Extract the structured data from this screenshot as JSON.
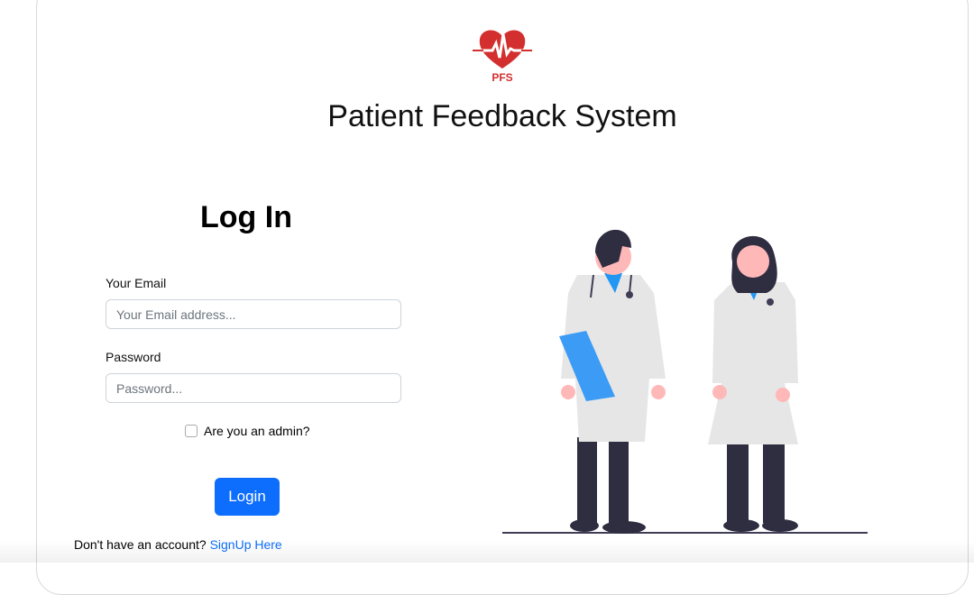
{
  "header": {
    "logo_text": "PFS",
    "title": "Patient Feedback System"
  },
  "form": {
    "heading": "Log In",
    "email_label": "Your Email",
    "email_placeholder": "Your Email address...",
    "password_label": "Password",
    "password_placeholder": "Password...",
    "admin_label": "Are you an admin?",
    "admin_checked": false,
    "login_label": "Login",
    "signup_prompt": "Don't have an account?",
    "signup_link": "SignUp Here"
  },
  "colors": {
    "brand": "#d32f2f",
    "primary": "#0d6efd"
  }
}
